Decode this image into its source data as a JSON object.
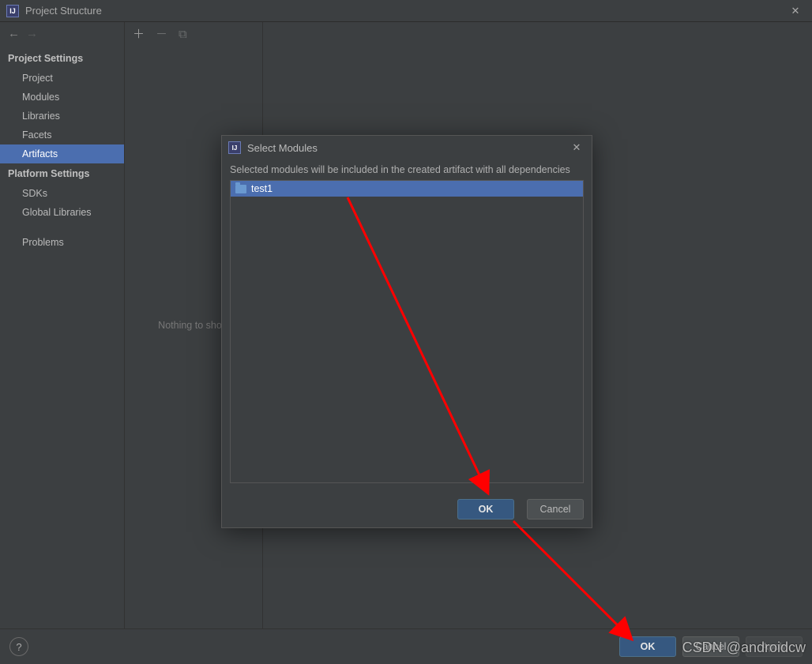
{
  "window": {
    "title": "Project Structure"
  },
  "sidebar": {
    "section1_title": "Project Settings",
    "items1": [
      "Project",
      "Modules",
      "Libraries",
      "Facets",
      "Artifacts"
    ],
    "section2_title": "Platform Settings",
    "items2": [
      "SDKs",
      "Global Libraries"
    ],
    "items3": [
      "Problems"
    ],
    "selected": "Artifacts"
  },
  "midcol": {
    "empty_text": "Nothing to show"
  },
  "modal": {
    "title": "Select Modules",
    "description": "Selected modules will be included in the created artifact with all dependencies",
    "items": [
      "test1"
    ],
    "ok": "OK",
    "cancel": "Cancel"
  },
  "bottom": {
    "ok": "OK",
    "cancel": "Cancel",
    "apply": "Apply",
    "help": "?"
  },
  "watermark": "CSDN @androidcw"
}
